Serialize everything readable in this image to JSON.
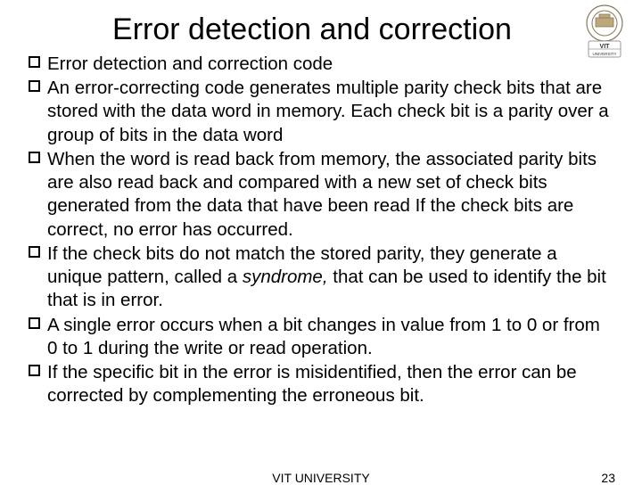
{
  "title": "Error detection and correction",
  "bullets": [
    "Error detection and correction code",
    "An error-correcting code generates multiple parity check bits that are stored with the data word in memory. Each check bit is a parity over a group of bits in the data word",
    "When the word is read back from memory, the associated parity bits are also read back and compared with a new set of check bits generated from the data that have been read If the check bits are correct, no error has occurred.",
    "If the check bits do not match the stored parity, they generate a unique pattern, called a <i>syndrome,</i> that can be used to identify the bit that is in error.",
    "A single error occurs when a bit changes in value from 1 to 0 or from 0 to 1 during the write or read operation.",
    "If the specific bit in the error is misidentified, then the error can be corrected by complementing the erroneous bit."
  ],
  "footer": {
    "center": "VIT UNIVERSITY",
    "page": "23"
  },
  "logo": {
    "name": "vit-university-seal",
    "top_text": "VIT",
    "bottom_text": "UNIVERSITY"
  }
}
